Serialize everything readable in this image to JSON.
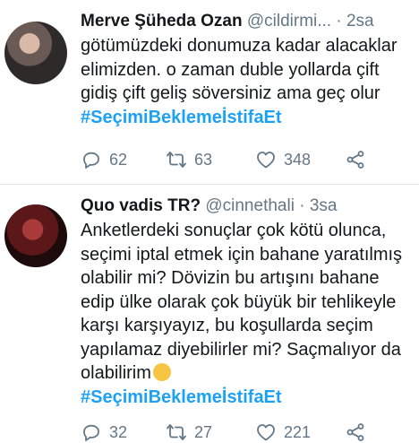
{
  "tweets": [
    {
      "name": "Merve Şüheda Ozan",
      "handle": "@cildirmi...",
      "separator": "·",
      "time": "2sa",
      "text": "götümüzdeki donumuza kadar alacaklar elimizden. o zaman duble yollarda çift gidiş çift geliş söversiniz ama geç olur",
      "hashtag": "#SeçimiBeklemeİstifaEt",
      "replies": "62",
      "retweets": "63",
      "likes": "348"
    },
    {
      "name": "Quo vadis TR?",
      "handle": "@cinnethali",
      "separator": "·",
      "time": "3sa",
      "text": "Anketlerdeki sonuçlar çok kötü olunca, seçimi iptal etmek için bahane yaratılmış olabilir mi? Dövizin bu artışını bahane edip ülke olarak çok büyük bir tehlikeyle karşı karşıyayız, bu koşullarda seçim yapılamaz diyebilirler mi? Saçmalıyor da olabilirim",
      "hashtag": "#SeçimiBeklemeİstifaEt",
      "replies": "32",
      "retweets": "27",
      "likes": "221"
    }
  ],
  "icons": {
    "reply": "reply-icon",
    "retweet": "retweet-icon",
    "like": "heart-icon",
    "share": "share-icon",
    "emoji": "thinking-face-emoji"
  }
}
